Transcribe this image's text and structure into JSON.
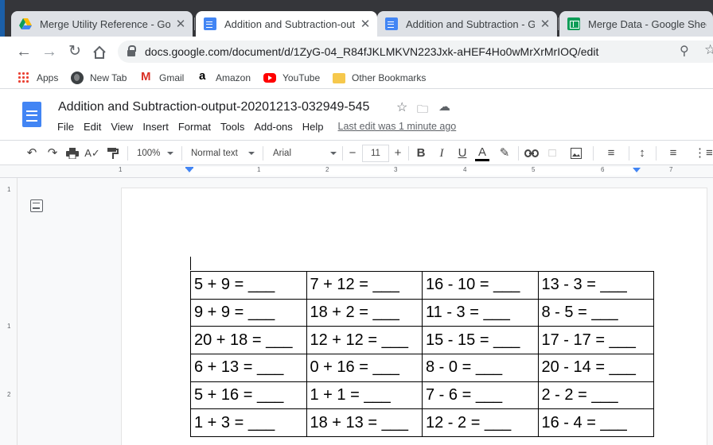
{
  "browser": {
    "tabs": [
      {
        "label": "Merge Utility Reference - Goog",
        "icon": "google-drive-icon",
        "active": false
      },
      {
        "label": "Addition and Subtraction-outp",
        "icon": "google-docs-icon",
        "active": true
      },
      {
        "label": "Addition and Subtraction - Goo",
        "icon": "google-docs-icon",
        "active": false
      },
      {
        "label": "Merge Data - Google Sheets",
        "icon": "google-sheets-icon",
        "active": false
      }
    ],
    "close_glyph": "✕",
    "url": "docs.google.com/document/d/1ZyG-04_R84fJKLMKVN223Jxk-aHEF4Ho0wMrXrMrIOQ/edit",
    "bookmarks": [
      {
        "label": "Apps",
        "icon": "apps-icon"
      },
      {
        "label": "New Tab",
        "icon": "globe-icon"
      },
      {
        "label": "Gmail",
        "icon": "gmail-icon"
      },
      {
        "label": "Amazon",
        "icon": "amazon-icon"
      },
      {
        "label": "YouTube",
        "icon": "youtube-icon"
      },
      {
        "label": "Other Bookmarks",
        "icon": "folder-icon"
      }
    ]
  },
  "doc": {
    "title": "Addition and Subtraction-output-20201213-032949-545",
    "menu": [
      "File",
      "Edit",
      "View",
      "Insert",
      "Format",
      "Tools",
      "Add-ons",
      "Help"
    ],
    "last_edit": "Last edit was 1 minute ago"
  },
  "toolbar": {
    "zoom": "100%",
    "style": "Normal text",
    "font": "Arial",
    "font_size": "11",
    "bold": "B",
    "italic": "I",
    "underline": "U",
    "text_color_letter": "A"
  },
  "ruler": {
    "marks": [
      "1",
      "1",
      "2",
      "3",
      "4",
      "5",
      "6",
      "7"
    ],
    "vertical_marks": [
      "1",
      "1",
      "2"
    ]
  },
  "worksheet": {
    "rows": [
      [
        "5 + 9 = ___",
        "7 + 12 = ___",
        "16 - 10 = ___",
        "13 - 3 = ___"
      ],
      [
        "9 + 9 = ___",
        "18 + 2 = ___",
        "11 - 3 = ___",
        "8 - 5 = ___"
      ],
      [
        "20 + 18 = ___",
        "12 + 12 = ___",
        "15 - 15 = ___",
        "17 - 17 = ___"
      ],
      [
        "6 + 13 = ___",
        "0 + 16 = ___",
        "8 - 0 = ___",
        "20 - 14 = ___"
      ],
      [
        "5 + 16 = ___",
        "1 + 1 = ___",
        "7 - 6 = ___",
        "2 - 2 = ___"
      ],
      [
        "1 + 3 = ___",
        "18 + 13 = ___",
        "12 - 2 = ___",
        "16 - 4 = ___"
      ]
    ]
  },
  "colors": {
    "tabstrip": "#35363a",
    "docs_blue": "#4285f4",
    "sheets_green": "#0f9d58"
  }
}
